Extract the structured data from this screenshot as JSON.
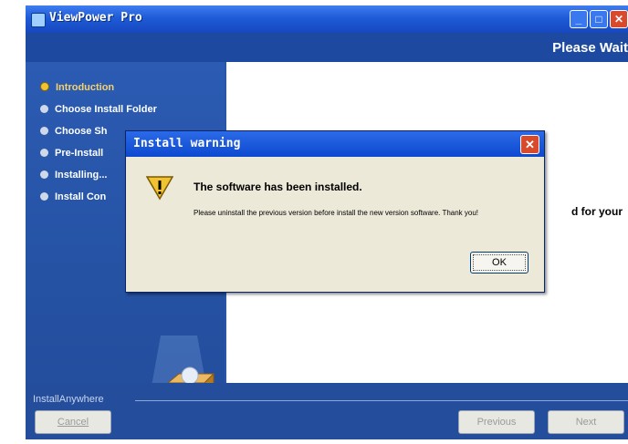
{
  "window": {
    "title": "ViewPower Pro",
    "header_text": "Please Wait",
    "controls": {
      "minimize": "_",
      "maximize": "□",
      "close": "✕"
    }
  },
  "steps": [
    {
      "label": "Introduction",
      "active": true
    },
    {
      "label": "Choose Install Folder",
      "active": false
    },
    {
      "label": "Choose Sh",
      "active": false
    },
    {
      "label": "Pre-Install",
      "active": false
    },
    {
      "label": "Installing...",
      "active": false
    },
    {
      "label": "Install Con",
      "active": false
    }
  ],
  "content": {
    "partial_text": "d for your"
  },
  "footer": {
    "brand": "InstallAnywhere",
    "cancel_label": "Cancel",
    "previous_label": "Previous",
    "next_label": "Next"
  },
  "dialog": {
    "title": "Install warning",
    "close": "✕",
    "heading": "The software has been installed.",
    "message": "Please uninstall the previous version before install the new version software. Thank you!",
    "ok_label": "OK",
    "icon": "warning-icon"
  },
  "colors": {
    "titlebar": "#1f5bd8",
    "panel": "#2a56a8",
    "dialog_bg": "#ece9d8",
    "close_red": "#d9492b",
    "warning_yellow": "#f1c232"
  }
}
